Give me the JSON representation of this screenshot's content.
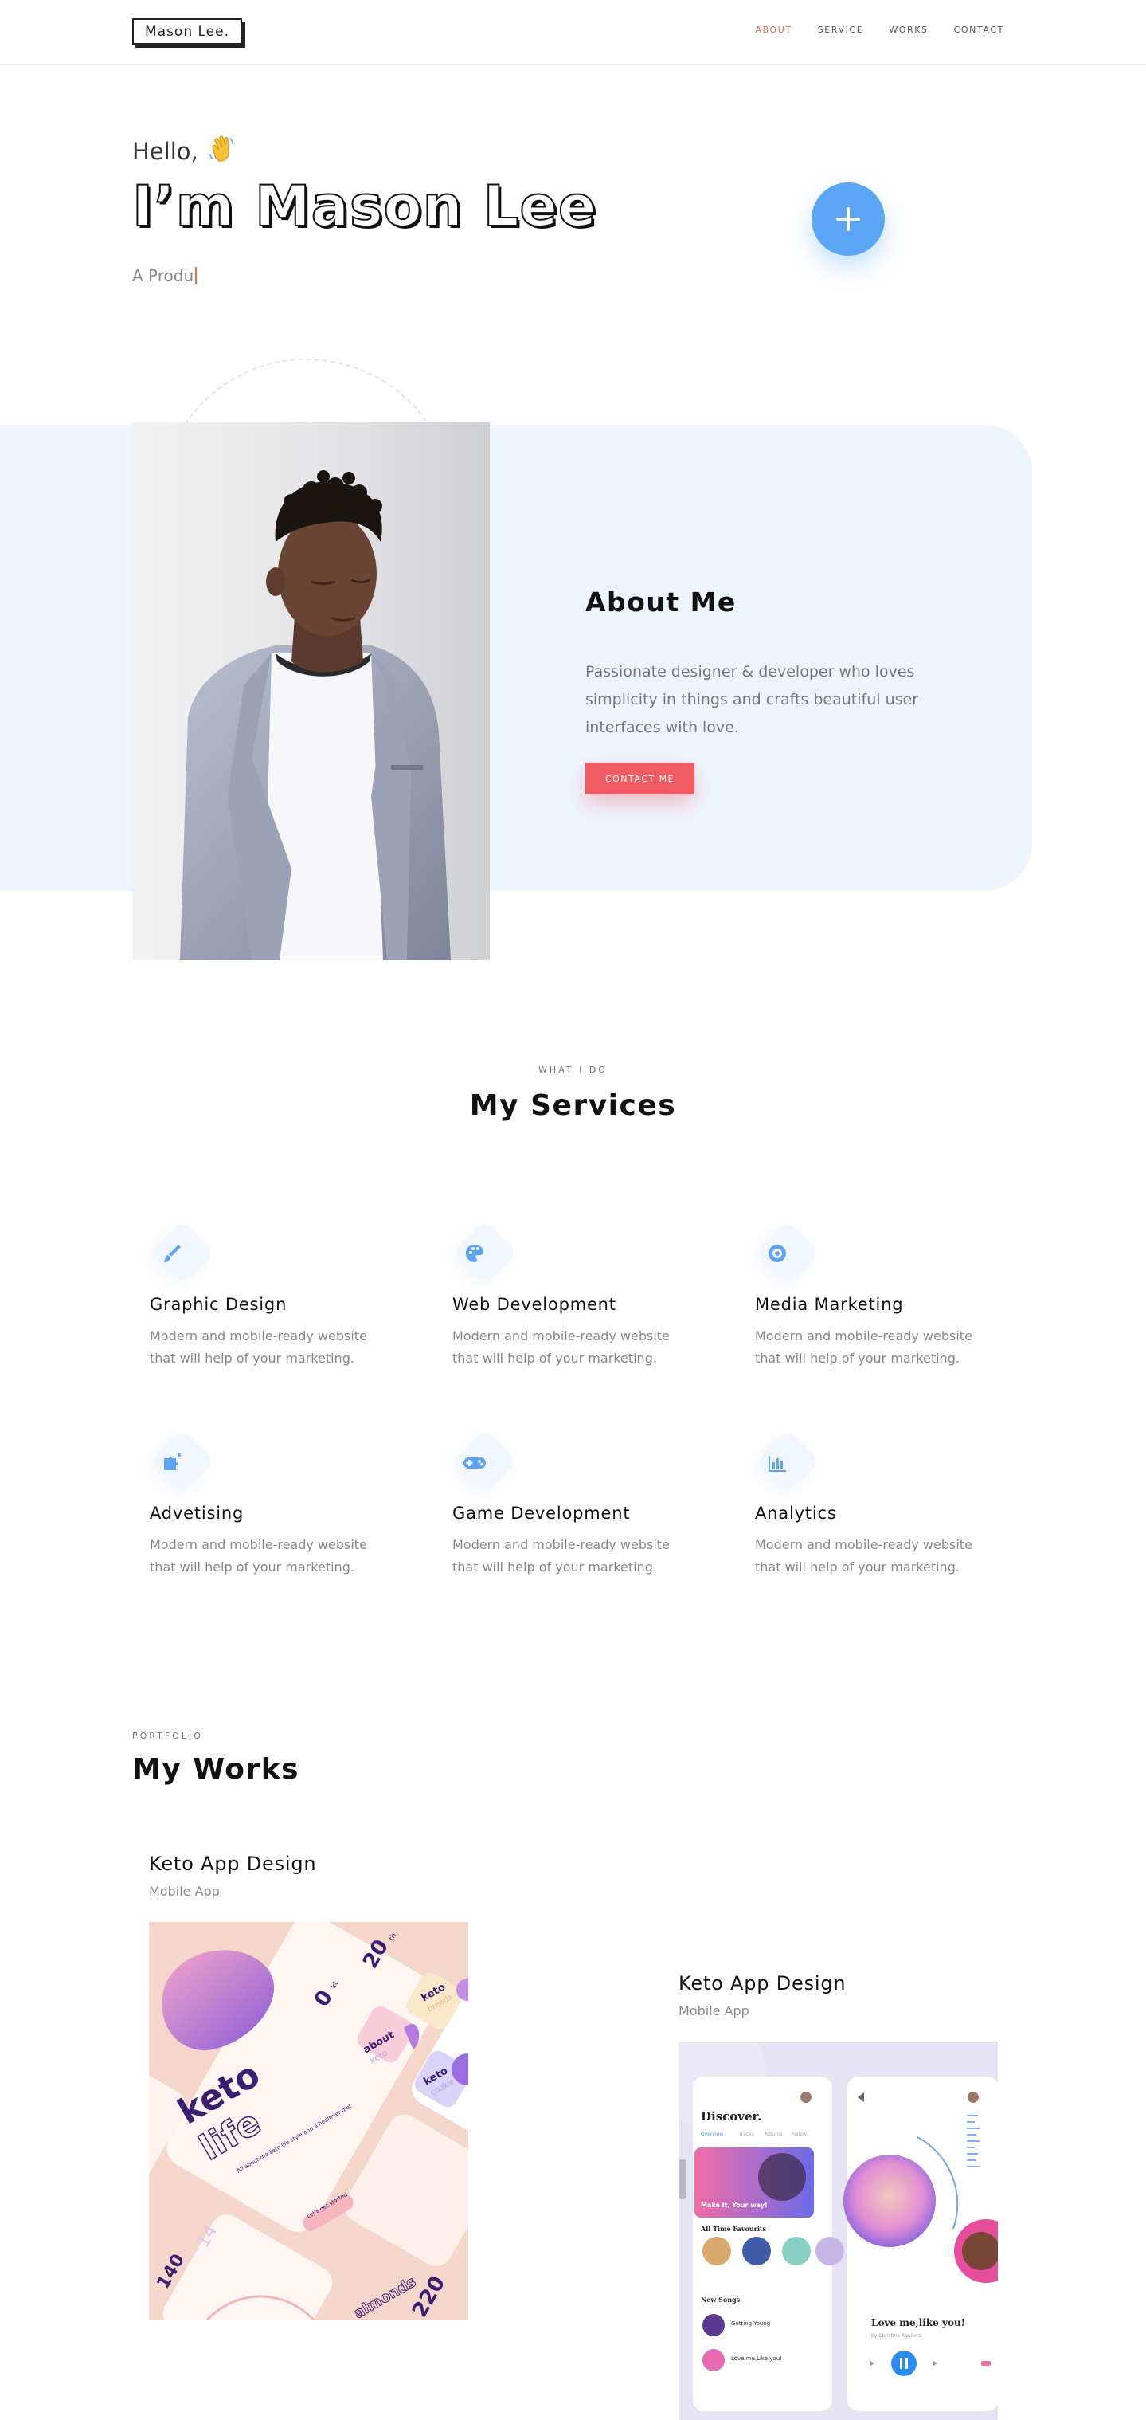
{
  "header": {
    "logo": "Mason Lee.",
    "nav": [
      {
        "label": "ABOUT",
        "active": true
      },
      {
        "label": "SERVICE",
        "active": false
      },
      {
        "label": "WORKS",
        "active": false
      },
      {
        "label": "CONTACT",
        "active": false
      }
    ]
  },
  "hero": {
    "greeting": "Hello,",
    "wave_icon": "waving-hand-icon",
    "name": "I’m Mason Lee",
    "typed_text": "A Produ",
    "fab_icon": "plus-icon"
  },
  "about": {
    "title": "About Me",
    "text": "Passionate designer & developer who loves simplicity in things and crafts beautiful user interfaces with love.",
    "button": "CONTACT ME"
  },
  "services": {
    "eyebrow": "WHAT I DO",
    "title": "My Services",
    "items": [
      {
        "icon": "brush-icon",
        "name": "Graphic Design",
        "desc": "Modern and mobile-ready website that will help of your marketing."
      },
      {
        "icon": "palette-icon",
        "name": "Web Development",
        "desc": "Modern and mobile-ready website that will help of your marketing."
      },
      {
        "icon": "target-icon",
        "name": "Media Marketing",
        "desc": "Modern and mobile-ready website that will help of your marketing."
      },
      {
        "icon": "puzzle-icon",
        "name": "Advetising",
        "desc": "Modern and mobile-ready website that will help of your marketing."
      },
      {
        "icon": "gamepad-icon",
        "name": "Game Development",
        "desc": "Modern and mobile-ready website that will help of your marketing."
      },
      {
        "icon": "bar-chart-icon",
        "name": "Analytics",
        "desc": "Modern and mobile-ready website that will help of your marketing."
      }
    ]
  },
  "works": {
    "eyebrow": "PORTFOLIO",
    "title": "My Works",
    "items": [
      {
        "title": "Keto App Design",
        "subtitle": "Mobile App",
        "mockup": {
          "brand": "keto",
          "brand_outline": "life",
          "tagline": "All about the keto life style and a healthier diet",
          "cta": "Let's get started",
          "stat1": "0",
          "stat1_unit": "kt",
          "stat2": "20",
          "stat2_unit": "th",
          "card1": "about",
          "card1_sub": "keto",
          "card2": "keto",
          "card2_sub": "breads",
          "card3": "keto",
          "card3_sub": "cookie",
          "num1": "140",
          "num2": "14",
          "num3": "220",
          "word": "almonds"
        }
      },
      {
        "title": "Keto App Design",
        "subtitle": "Mobile App",
        "mockup": {
          "discover": "Discover.",
          "tabs": [
            "Overview",
            "Tracks",
            "Albums",
            "Follow"
          ],
          "banner_line1": "Make It, Your way!",
          "section1": "All Time Favourits",
          "section2": "New Songs",
          "songs": [
            "Getting Young",
            "Love me,Like you!"
          ],
          "now_playing": "Love me,like you!",
          "artist": "by Christina Aguilera"
        }
      }
    ]
  },
  "colors": {
    "accent": "#f06b5a",
    "blue": "#5aa6f5",
    "band": "#eef5fe",
    "button": "#ef5b61"
  }
}
